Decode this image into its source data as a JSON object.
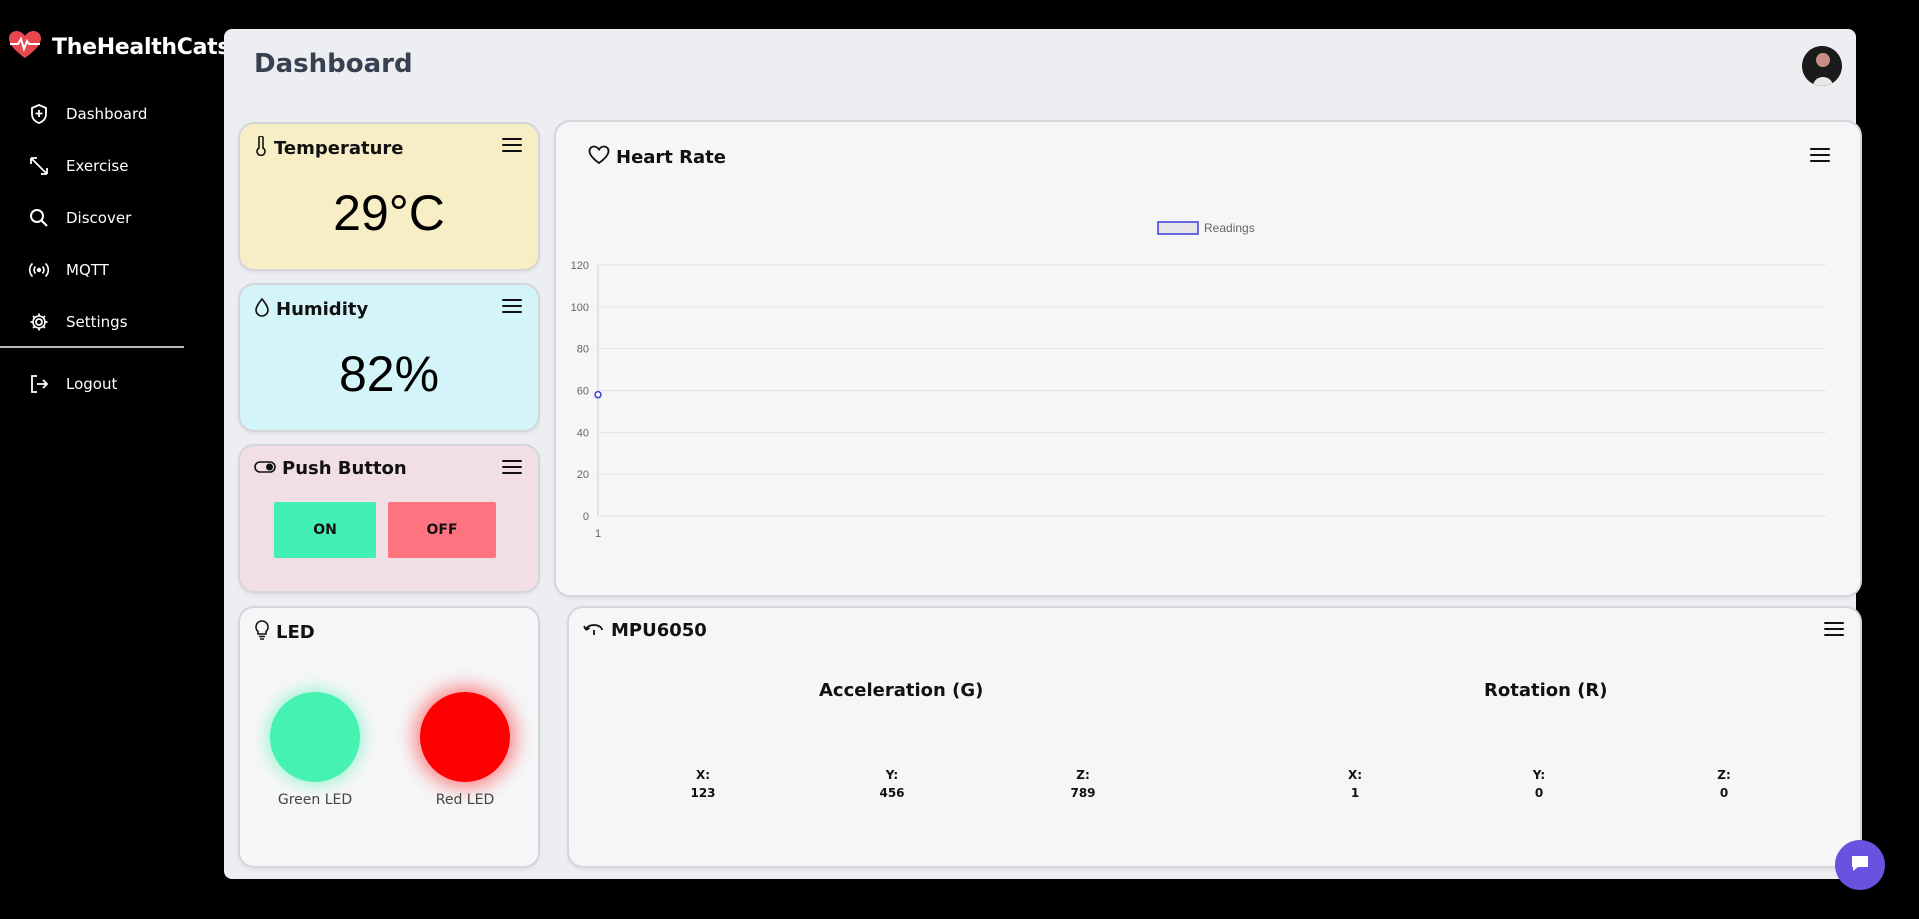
{
  "brand": {
    "name": "TheHealthCats",
    "accent": "#e8474f"
  },
  "sidebar": {
    "items": [
      {
        "label": "Dashboard",
        "icon": "shield-icon"
      },
      {
        "label": "Exercise",
        "icon": "expand-arrows-icon"
      },
      {
        "label": "Discover",
        "icon": "search-icon"
      },
      {
        "label": "MQTT",
        "icon": "broadcast-icon"
      },
      {
        "label": "Settings",
        "icon": "gear-icon"
      }
    ],
    "logout": {
      "label": "Logout",
      "icon": "logout-icon"
    }
  },
  "header": {
    "title": "Dashboard"
  },
  "temperature": {
    "title": "Temperature",
    "value": "29°C",
    "icon": "thermometer-icon",
    "color": "#f8eec5"
  },
  "humidity": {
    "title": "Humidity",
    "value": "82%",
    "icon": "droplet-icon",
    "color": "#d3f4f9"
  },
  "push_button": {
    "title": "Push Button",
    "on_label": "ON",
    "off_label": "OFF",
    "icon": "toggle-icon",
    "on_color": "#43f0b3",
    "off_color": "#fd7380"
  },
  "led": {
    "title": "LED",
    "green_label": "Green LED",
    "red_label": "Red LED",
    "icon": "bulb-icon",
    "green_color": "#45f2b1",
    "red_color": "#ff0000"
  },
  "heart_rate": {
    "title": "Heart Rate",
    "icon": "heart-icon"
  },
  "mpu": {
    "title": "MPU6050",
    "icon": "rotate-icon",
    "acceleration": {
      "title": "Acceleration (G)",
      "x_label": "X:",
      "y_label": "Y:",
      "z_label": "Z:",
      "x": "123",
      "y": "456",
      "z": "789"
    },
    "rotation": {
      "title": "Rotation (R)",
      "x_label": "X:",
      "y_label": "Y:",
      "z_label": "Z:",
      "x": "1",
      "y": "0",
      "z": "0"
    }
  },
  "chart_data": {
    "type": "line",
    "title": "",
    "xlabel": "",
    "ylabel": "",
    "x": [
      "1"
    ],
    "series": [
      {
        "name": "Readings",
        "values": [
          58
        ],
        "color": "#3b3bd6"
      }
    ],
    "ylim": [
      0,
      120
    ],
    "yticks": [
      0,
      20,
      40,
      60,
      80,
      100,
      120
    ],
    "grid": true,
    "legend": "top-center"
  }
}
